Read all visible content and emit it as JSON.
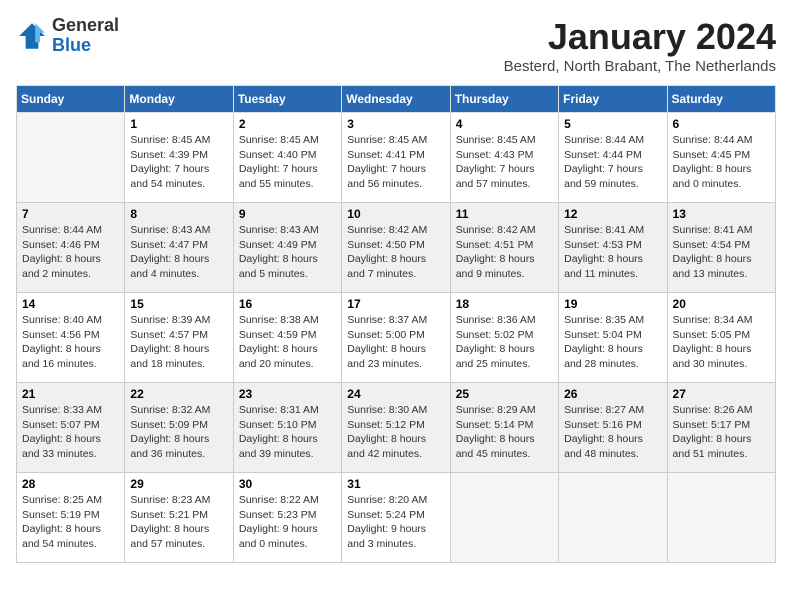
{
  "logo": {
    "general": "General",
    "blue": "Blue"
  },
  "title": "January 2024",
  "subtitle": "Besterd, North Brabant, The Netherlands",
  "weekdays": [
    "Sunday",
    "Monday",
    "Tuesday",
    "Wednesday",
    "Thursday",
    "Friday",
    "Saturday"
  ],
  "weeks": [
    [
      {
        "day": "",
        "sunrise": "",
        "sunset": "",
        "daylight": "",
        "empty": true
      },
      {
        "day": "1",
        "sunrise": "Sunrise: 8:45 AM",
        "sunset": "Sunset: 4:39 PM",
        "daylight": "Daylight: 7 hours and 54 minutes."
      },
      {
        "day": "2",
        "sunrise": "Sunrise: 8:45 AM",
        "sunset": "Sunset: 4:40 PM",
        "daylight": "Daylight: 7 hours and 55 minutes."
      },
      {
        "day": "3",
        "sunrise": "Sunrise: 8:45 AM",
        "sunset": "Sunset: 4:41 PM",
        "daylight": "Daylight: 7 hours and 56 minutes."
      },
      {
        "day": "4",
        "sunrise": "Sunrise: 8:45 AM",
        "sunset": "Sunset: 4:43 PM",
        "daylight": "Daylight: 7 hours and 57 minutes."
      },
      {
        "day": "5",
        "sunrise": "Sunrise: 8:44 AM",
        "sunset": "Sunset: 4:44 PM",
        "daylight": "Daylight: 7 hours and 59 minutes."
      },
      {
        "day": "6",
        "sunrise": "Sunrise: 8:44 AM",
        "sunset": "Sunset: 4:45 PM",
        "daylight": "Daylight: 8 hours and 0 minutes."
      }
    ],
    [
      {
        "day": "7",
        "sunrise": "Sunrise: 8:44 AM",
        "sunset": "Sunset: 4:46 PM",
        "daylight": "Daylight: 8 hours and 2 minutes."
      },
      {
        "day": "8",
        "sunrise": "Sunrise: 8:43 AM",
        "sunset": "Sunset: 4:47 PM",
        "daylight": "Daylight: 8 hours and 4 minutes."
      },
      {
        "day": "9",
        "sunrise": "Sunrise: 8:43 AM",
        "sunset": "Sunset: 4:49 PM",
        "daylight": "Daylight: 8 hours and 5 minutes."
      },
      {
        "day": "10",
        "sunrise": "Sunrise: 8:42 AM",
        "sunset": "Sunset: 4:50 PM",
        "daylight": "Daylight: 8 hours and 7 minutes."
      },
      {
        "day": "11",
        "sunrise": "Sunrise: 8:42 AM",
        "sunset": "Sunset: 4:51 PM",
        "daylight": "Daylight: 8 hours and 9 minutes."
      },
      {
        "day": "12",
        "sunrise": "Sunrise: 8:41 AM",
        "sunset": "Sunset: 4:53 PM",
        "daylight": "Daylight: 8 hours and 11 minutes."
      },
      {
        "day": "13",
        "sunrise": "Sunrise: 8:41 AM",
        "sunset": "Sunset: 4:54 PM",
        "daylight": "Daylight: 8 hours and 13 minutes."
      }
    ],
    [
      {
        "day": "14",
        "sunrise": "Sunrise: 8:40 AM",
        "sunset": "Sunset: 4:56 PM",
        "daylight": "Daylight: 8 hours and 16 minutes."
      },
      {
        "day": "15",
        "sunrise": "Sunrise: 8:39 AM",
        "sunset": "Sunset: 4:57 PM",
        "daylight": "Daylight: 8 hours and 18 minutes."
      },
      {
        "day": "16",
        "sunrise": "Sunrise: 8:38 AM",
        "sunset": "Sunset: 4:59 PM",
        "daylight": "Daylight: 8 hours and 20 minutes."
      },
      {
        "day": "17",
        "sunrise": "Sunrise: 8:37 AM",
        "sunset": "Sunset: 5:00 PM",
        "daylight": "Daylight: 8 hours and 23 minutes."
      },
      {
        "day": "18",
        "sunrise": "Sunrise: 8:36 AM",
        "sunset": "Sunset: 5:02 PM",
        "daylight": "Daylight: 8 hours and 25 minutes."
      },
      {
        "day": "19",
        "sunrise": "Sunrise: 8:35 AM",
        "sunset": "Sunset: 5:04 PM",
        "daylight": "Daylight: 8 hours and 28 minutes."
      },
      {
        "day": "20",
        "sunrise": "Sunrise: 8:34 AM",
        "sunset": "Sunset: 5:05 PM",
        "daylight": "Daylight: 8 hours and 30 minutes."
      }
    ],
    [
      {
        "day": "21",
        "sunrise": "Sunrise: 8:33 AM",
        "sunset": "Sunset: 5:07 PM",
        "daylight": "Daylight: 8 hours and 33 minutes."
      },
      {
        "day": "22",
        "sunrise": "Sunrise: 8:32 AM",
        "sunset": "Sunset: 5:09 PM",
        "daylight": "Daylight: 8 hours and 36 minutes."
      },
      {
        "day": "23",
        "sunrise": "Sunrise: 8:31 AM",
        "sunset": "Sunset: 5:10 PM",
        "daylight": "Daylight: 8 hours and 39 minutes."
      },
      {
        "day": "24",
        "sunrise": "Sunrise: 8:30 AM",
        "sunset": "Sunset: 5:12 PM",
        "daylight": "Daylight: 8 hours and 42 minutes."
      },
      {
        "day": "25",
        "sunrise": "Sunrise: 8:29 AM",
        "sunset": "Sunset: 5:14 PM",
        "daylight": "Daylight: 8 hours and 45 minutes."
      },
      {
        "day": "26",
        "sunrise": "Sunrise: 8:27 AM",
        "sunset": "Sunset: 5:16 PM",
        "daylight": "Daylight: 8 hours and 48 minutes."
      },
      {
        "day": "27",
        "sunrise": "Sunrise: 8:26 AM",
        "sunset": "Sunset: 5:17 PM",
        "daylight": "Daylight: 8 hours and 51 minutes."
      }
    ],
    [
      {
        "day": "28",
        "sunrise": "Sunrise: 8:25 AM",
        "sunset": "Sunset: 5:19 PM",
        "daylight": "Daylight: 8 hours and 54 minutes."
      },
      {
        "day": "29",
        "sunrise": "Sunrise: 8:23 AM",
        "sunset": "Sunset: 5:21 PM",
        "daylight": "Daylight: 8 hours and 57 minutes."
      },
      {
        "day": "30",
        "sunrise": "Sunrise: 8:22 AM",
        "sunset": "Sunset: 5:23 PM",
        "daylight": "Daylight: 9 hours and 0 minutes."
      },
      {
        "day": "31",
        "sunrise": "Sunrise: 8:20 AM",
        "sunset": "Sunset: 5:24 PM",
        "daylight": "Daylight: 9 hours and 3 minutes."
      },
      {
        "day": "",
        "sunrise": "",
        "sunset": "",
        "daylight": "",
        "empty": true
      },
      {
        "day": "",
        "sunrise": "",
        "sunset": "",
        "daylight": "",
        "empty": true
      },
      {
        "day": "",
        "sunrise": "",
        "sunset": "",
        "daylight": "",
        "empty": true
      }
    ]
  ]
}
